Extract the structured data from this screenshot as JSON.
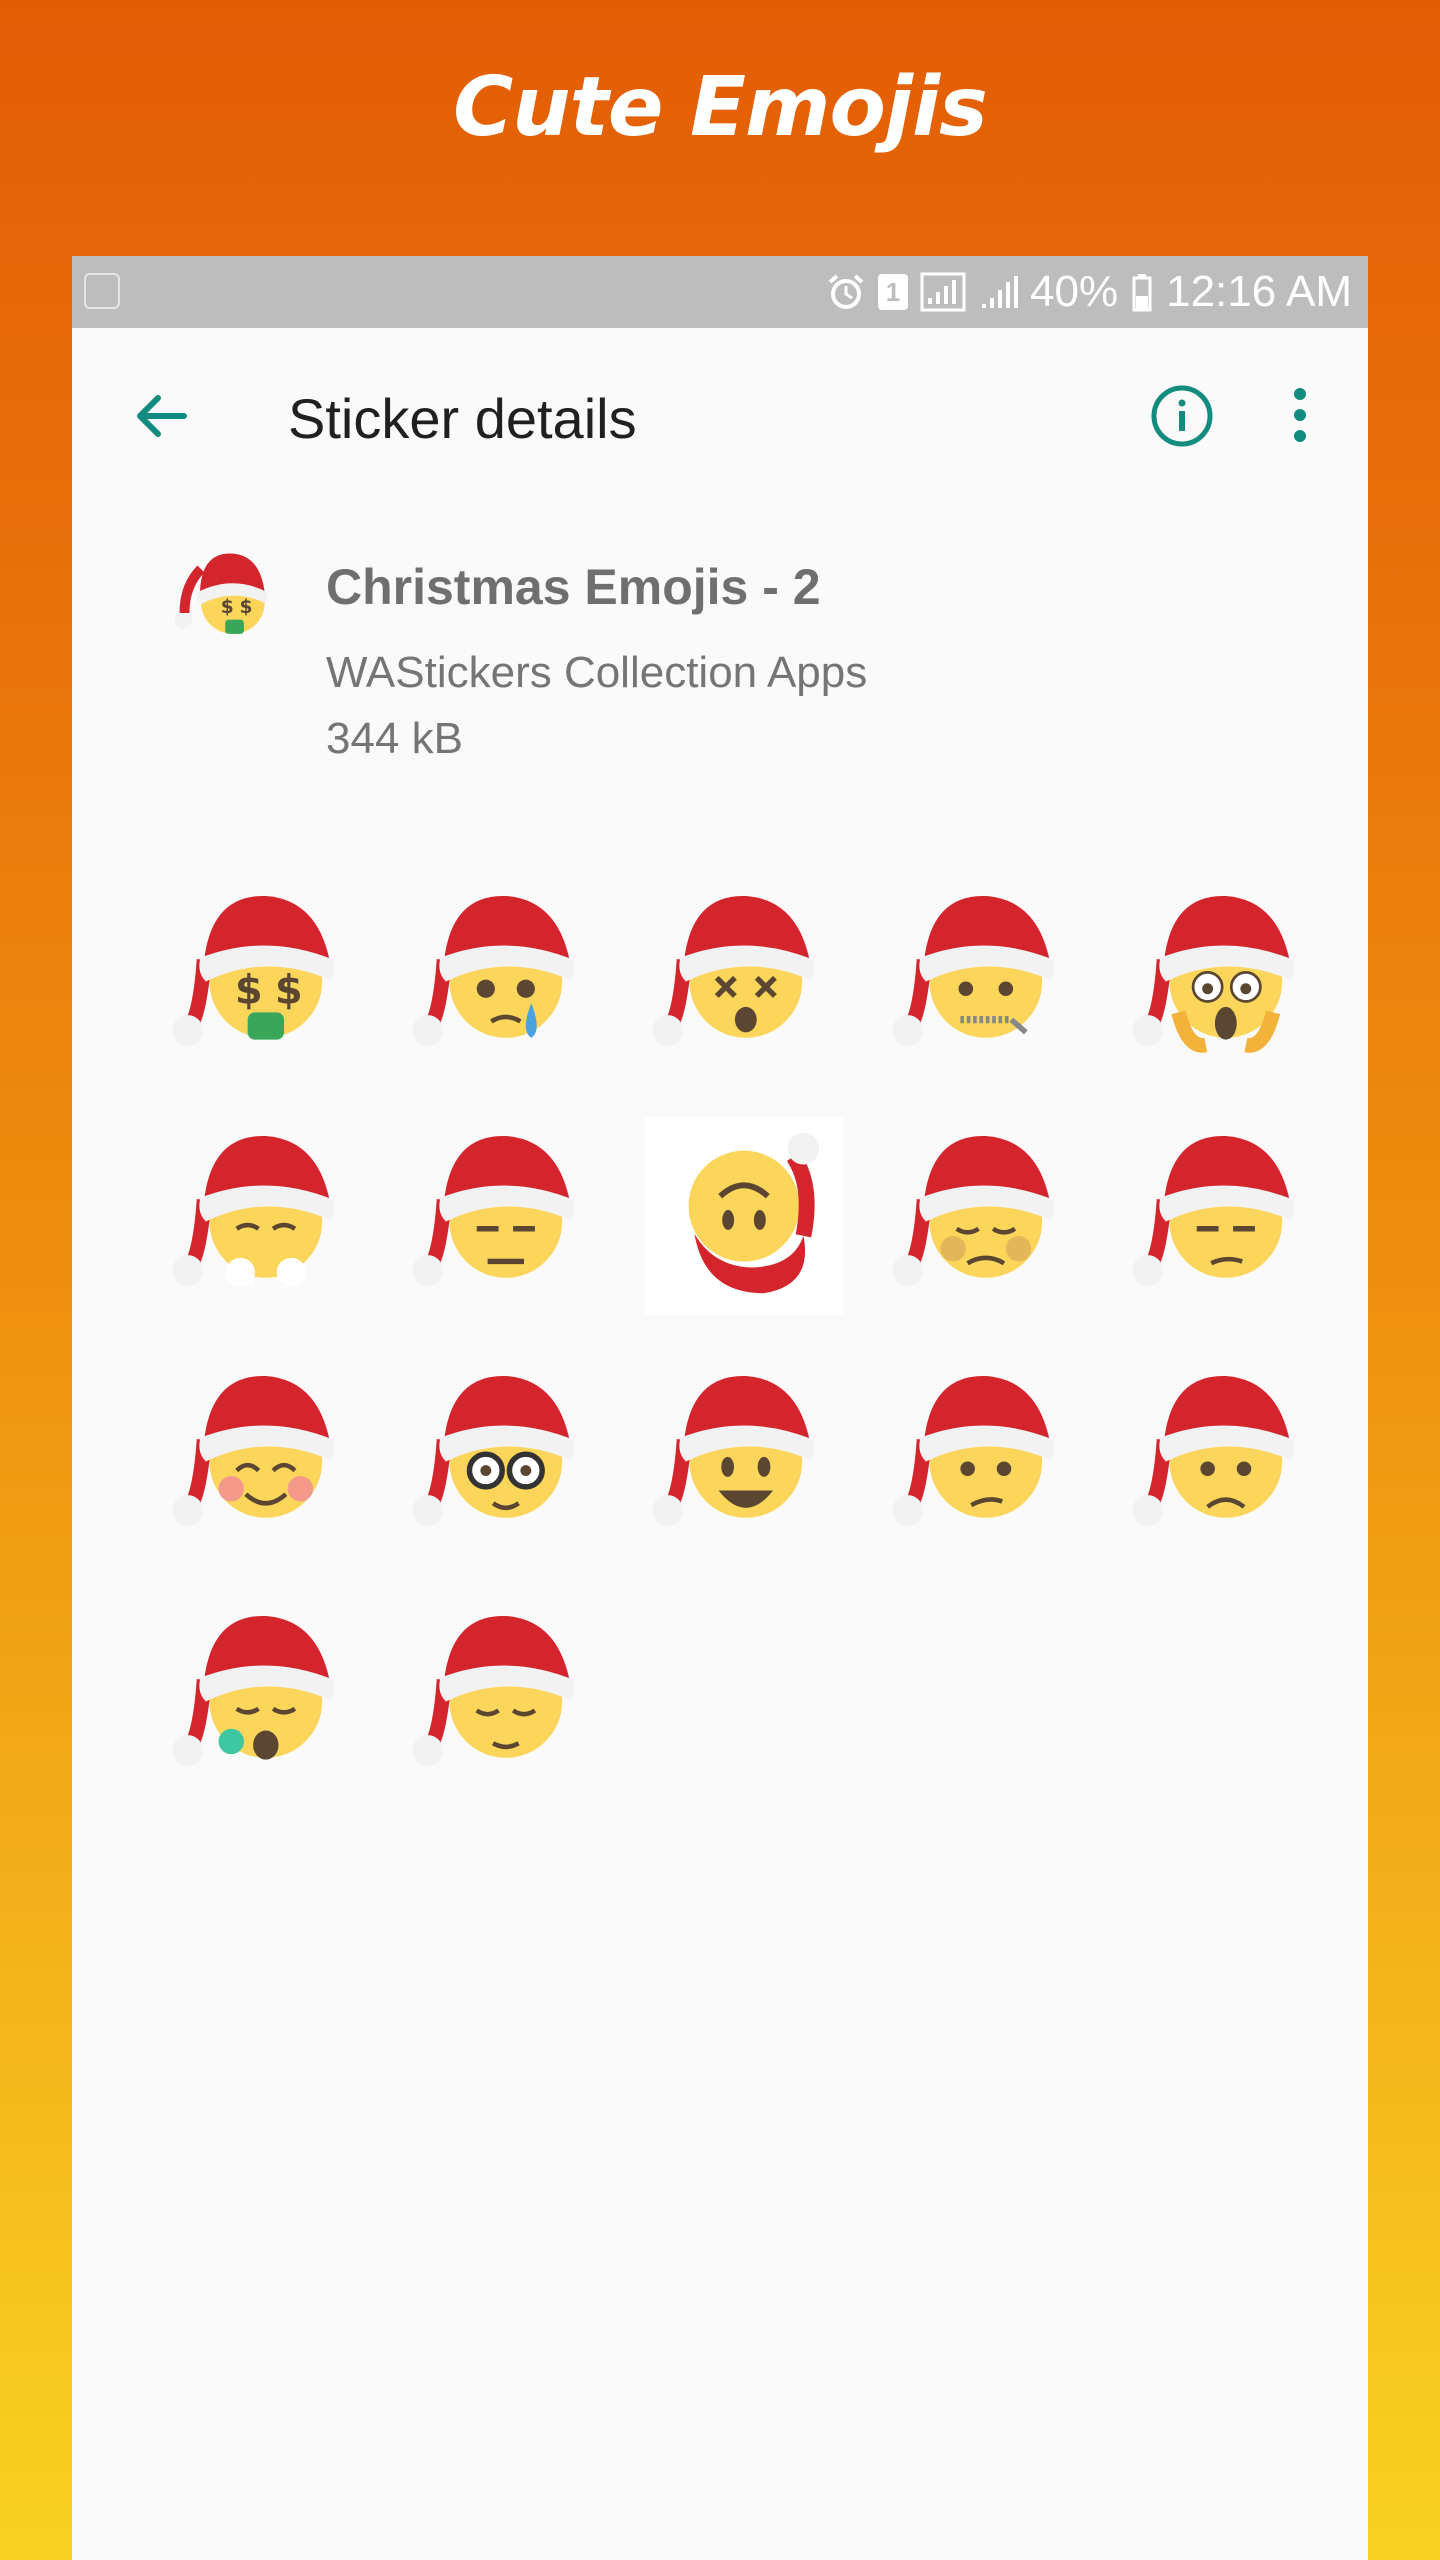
{
  "promo": {
    "title": "Cute Emojis"
  },
  "status_bar": {
    "battery": "40%",
    "time": "12:16 AM",
    "sim": "1"
  },
  "toolbar": {
    "title": "Sticker details",
    "back_icon": "arrow-back-icon",
    "info_icon": "info-icon",
    "more_icon": "more-vert-icon",
    "accent_color": "#128c7e"
  },
  "pack": {
    "name": "Christmas Emojis - 2",
    "publisher": "WAStickers Collection Apps",
    "size": "344 kB",
    "tray_icon": "money-mouth-santa-icon"
  },
  "stickers": [
    {
      "name": "money-mouth-face-santa-sticker"
    },
    {
      "name": "sad-relieved-face-santa-sticker"
    },
    {
      "name": "dizzy-face-santa-sticker"
    },
    {
      "name": "zipper-mouth-face-santa-sticker"
    },
    {
      "name": "screaming-face-santa-sticker"
    },
    {
      "name": "steam-nose-face-santa-sticker"
    },
    {
      "name": "expressionless-face-santa-sticker"
    },
    {
      "name": "upside-down-face-santa-sticker"
    },
    {
      "name": "nauseated-face-santa-sticker"
    },
    {
      "name": "unamused-face-santa-sticker"
    },
    {
      "name": "blushing-smile-face-santa-sticker"
    },
    {
      "name": "nerd-face-santa-sticker"
    },
    {
      "name": "grinning-face-santa-sticker"
    },
    {
      "name": "confused-face-santa-sticker"
    },
    {
      "name": "frowning-face-santa-sticker"
    },
    {
      "name": "sleeping-face-santa-sticker"
    },
    {
      "name": "relieved-face-santa-sticker"
    }
  ],
  "colors": {
    "santa_hat": "#d4242c",
    "fur": "#f2f2f2",
    "face": "#fbd65a",
    "feature": "#5b4632"
  }
}
